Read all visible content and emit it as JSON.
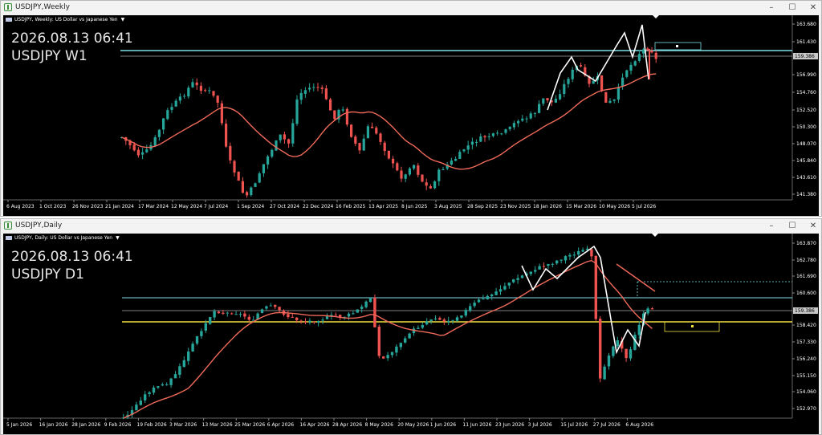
{
  "windows": [
    {
      "id": "weekly",
      "title": "USDJPY,Weekly",
      "info": "USDJPY, Weekly:  US Dollar vs Japanese Yen",
      "overlay_datetime": "2026.08.13 06:41",
      "overlay_symbol": "USDJPY W1",
      "price_labels": [
        "163.680",
        "161.430",
        "159.386",
        "156.990",
        "154.760",
        "152.520",
        "150.300",
        "148.070",
        "145.840",
        "143.610",
        "141.380"
      ],
      "current_price": "159.386",
      "date_labels": [
        "6 Aug 2023",
        "1 Oct 2023",
        "26 Nov 2023",
        "21 Jan 2024",
        "17 Mar 2024",
        "12 May 2024",
        "7 Jul 2024",
        "1 Sep 2024",
        "27 Oct 2024",
        "22 Dec 2024",
        "16 Feb 2025",
        "13 Apr 2025",
        "8 Jun 2025",
        "3 Aug 2025",
        "28 Sep 2025",
        "23 Nov 2025",
        "18 Jan 2026",
        "15 Mar 2026",
        "10 May 2026",
        "5 Jul 2026"
      ]
    },
    {
      "id": "daily",
      "title": "USDJPY,Daily",
      "info": "USDJPY, Daily:  US Dollar vs Japanese Yen",
      "overlay_datetime": "2026.08.13 06:41",
      "overlay_symbol": "USDJPY D1",
      "price_labels": [
        "163.870",
        "162.780",
        "161.690",
        "160.600",
        "159.386",
        "158.420",
        "157.330",
        "156.240",
        "155.150",
        "154.060",
        "152.970"
      ],
      "current_price": "159.386",
      "date_labels": [
        "5 Jan 2026",
        "16 Jan 2026",
        "28 Jan 2026",
        "9 Feb 2026",
        "19 Feb 2026",
        "3 Mar 2026",
        "13 Mar 2026",
        "25 Mar 2026",
        "6 Apr 2026",
        "16 Apr 2026",
        "28 Apr 2026",
        "8 May 2026",
        "20 May 2026",
        "1 Jun 2026",
        "11 Jun 2026",
        "23 Jun 2026",
        "3 Jul 2026",
        "15 Jul 2026",
        "27 Jul 2026",
        "6 Aug 2026"
      ]
    }
  ],
  "colors": {
    "bull": "#26a69a",
    "bear": "#ef5350",
    "ma": "#f06a5a",
    "zigzag": "#ffffff",
    "cyan_line": "#7fe0e8",
    "yellow_line": "#f0e040",
    "grid": "#2a2a2a",
    "axis_text": "#ffffff"
  },
  "controls": {
    "minimize": "–",
    "maximize": "☐",
    "close": "✕"
  }
}
